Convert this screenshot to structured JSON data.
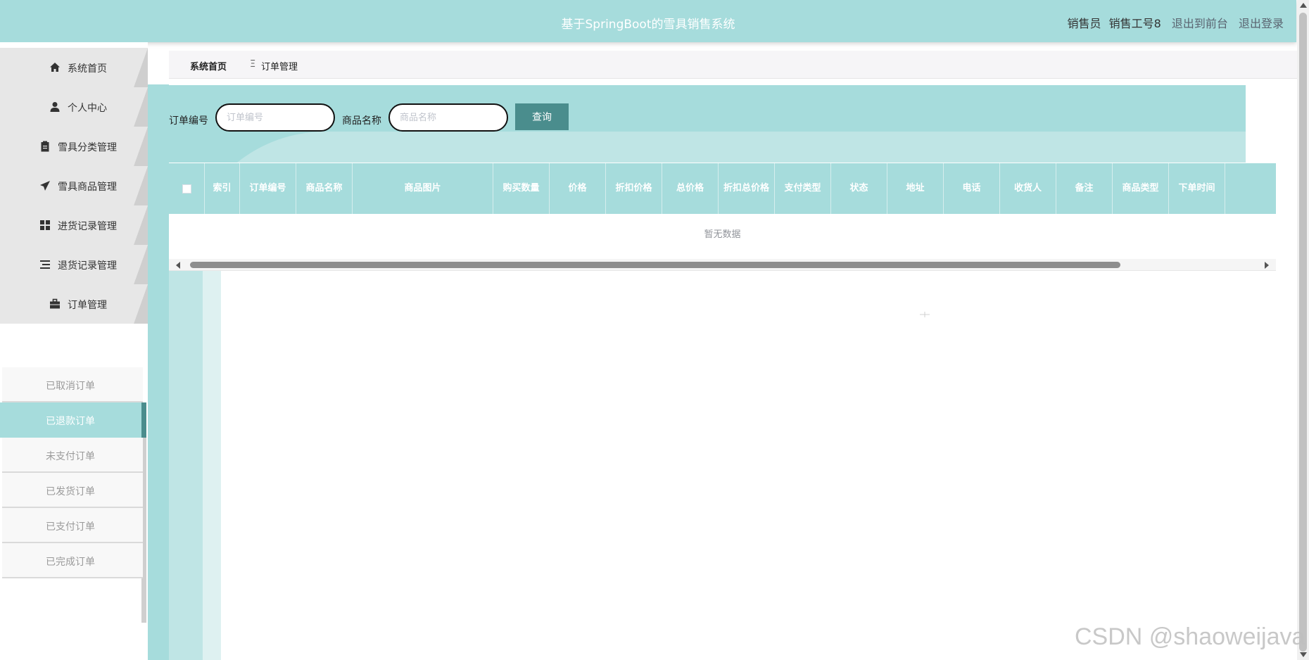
{
  "header": {
    "title": "基于SpringBoot的雪具销售系统",
    "role": "销售员",
    "username": "销售工号8",
    "to_front": "退出到前台",
    "logout": "退出登录"
  },
  "sidebar": {
    "items": [
      {
        "label": "系统首页",
        "icon": "home-icon"
      },
      {
        "label": "个人中心",
        "icon": "user-icon"
      },
      {
        "label": "雪具分类管理",
        "icon": "clipboard-icon"
      },
      {
        "label": "雪具商品管理",
        "icon": "send-icon"
      },
      {
        "label": "进货记录管理",
        "icon": "grid-icon"
      },
      {
        "label": "退货记录管理",
        "icon": "list-icon"
      },
      {
        "label": "订单管理",
        "icon": "briefcase-icon"
      }
    ],
    "submenu": [
      {
        "label": "已取消订单",
        "active": false
      },
      {
        "label": "已退款订单",
        "active": true
      },
      {
        "label": "未支付订单",
        "active": false
      },
      {
        "label": "已发货订单",
        "active": false
      },
      {
        "label": "已支付订单",
        "active": false
      },
      {
        "label": "已完成订单",
        "active": false
      }
    ]
  },
  "breadcrumb": {
    "home": "系统首页",
    "separator": "Ξ",
    "current": "订单管理"
  },
  "search": {
    "order_no_label": "订单编号",
    "order_no_placeholder": "订单编号",
    "product_name_label": "商品名称",
    "product_name_placeholder": "商品名称",
    "query_button": "查询"
  },
  "table": {
    "columns": [
      "索引",
      "订单编号",
      "商品名称",
      "商品图片",
      "购买数量",
      "价格",
      "折扣价格",
      "总价格",
      "折扣总价格",
      "支付类型",
      "状态",
      "地址",
      "电话",
      "收货人",
      "备注",
      "商品类型",
      "下单时间"
    ],
    "empty_text": "暂无数据"
  },
  "watermark": "CSDN @shaoweijava",
  "colors": {
    "accent": "#a6dcdc",
    "accent_dark": "#4a8d8d",
    "sidebar_bg": "#e7e7e7"
  }
}
